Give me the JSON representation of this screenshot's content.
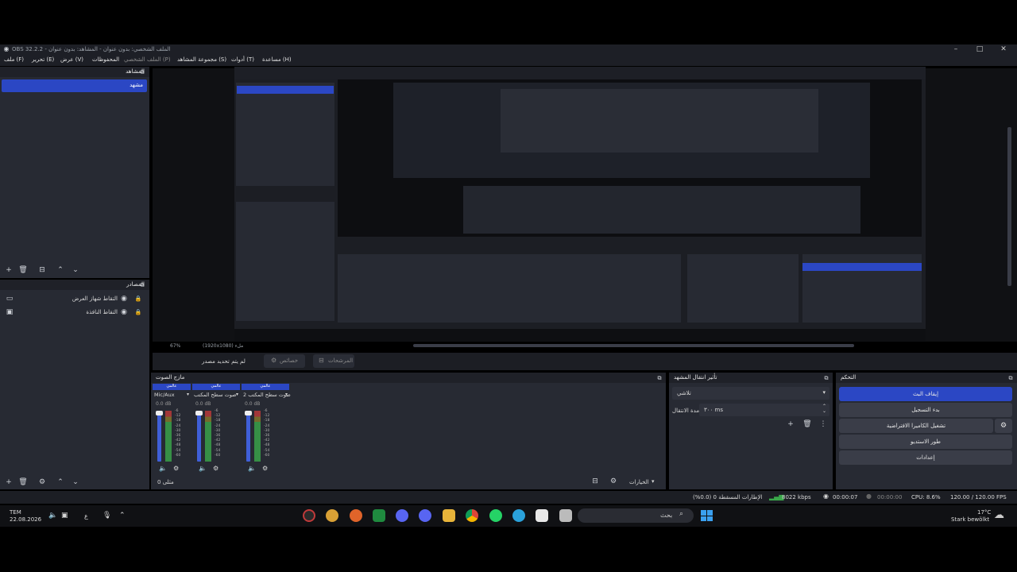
{
  "window": {
    "title": "OBS 32.2.2 - الملف الشخصي: بدون عنوان - المشاهد: بدون عنوان",
    "min_icon": "minimize-icon",
    "max_icon": "maximize-icon",
    "close_icon": "close-icon"
  },
  "menu": {
    "items": [
      "ملف (F)",
      "تحرير (E)",
      "عرض (V)",
      "المحفوظات",
      "الملف الشخصي (P)",
      "مجموعة المشاهد (S)",
      "أدوات (T)",
      "مساعدة (H)"
    ]
  },
  "scenes": {
    "title": "المشاهد",
    "items": [
      "مشهد"
    ]
  },
  "sources": {
    "title": "المصادر",
    "items": [
      "التقاط شهاز العرض",
      "التقاط النافذة"
    ]
  },
  "preview_status": {
    "zoom": "67%",
    "canvas": "(1920x1080) ملء"
  },
  "context_bar": {
    "no_source": "لم يتم تحديد مصدر",
    "properties": "خصائص",
    "filters": "المرشحات"
  },
  "mixer": {
    "title": "مازج الصوت",
    "channels": [
      {
        "state": "عالمي",
        "name": "Mic/Aux",
        "db": "0.0 dB"
      },
      {
        "state": "عالمي",
        "name": "صوت سطح المكتب",
        "db": "0.0 dB"
      },
      {
        "state": "عالمي",
        "name": "صوت سطح المكتب 2",
        "db": "0.0 dB"
      }
    ],
    "scale": [
      "-6",
      "-12",
      "-18",
      "-24",
      "-30",
      "-36",
      "-42",
      "-48",
      "-54",
      "-60"
    ],
    "footer_left": "0 مثلى",
    "options": "الخيارات"
  },
  "transitions": {
    "title": "تأثير انتقال المشهد",
    "type": "تلاشي",
    "duration_label": "مدة الانتقال",
    "duration_value": "٣٠٠ ms"
  },
  "controls": {
    "title": "التحكم",
    "stop_stream": "إيقاف البث",
    "start_record": "بدء التسجيل",
    "virtual_cam": "تشغيل الكاميرا الافتراضية",
    "studio_mode": "طور الاستديو",
    "settings": "إعدادات"
  },
  "status": {
    "dropped": "الإطارات المسقطة 0 (0.0%)",
    "bitrate": "8022 kbps",
    "stream_time": "00:00:07",
    "rec_time": "00:00:00",
    "cpu": "CPU: 8.6%",
    "fps": "120.00 / 120.00 FPS"
  },
  "taskbar": {
    "time": "TEM",
    "date": "22.08.2026",
    "lang": "ع",
    "search_placeholder": "بحث",
    "weather_temp": "17°C",
    "weather_desc": "Stark bewölkt"
  },
  "colors": {
    "accent": "#2b47c4",
    "dock": "#272a33",
    "meter_green": "#3aa84a",
    "meter_red": "#c03a3a",
    "meter_blue": "#3f5fd8"
  }
}
